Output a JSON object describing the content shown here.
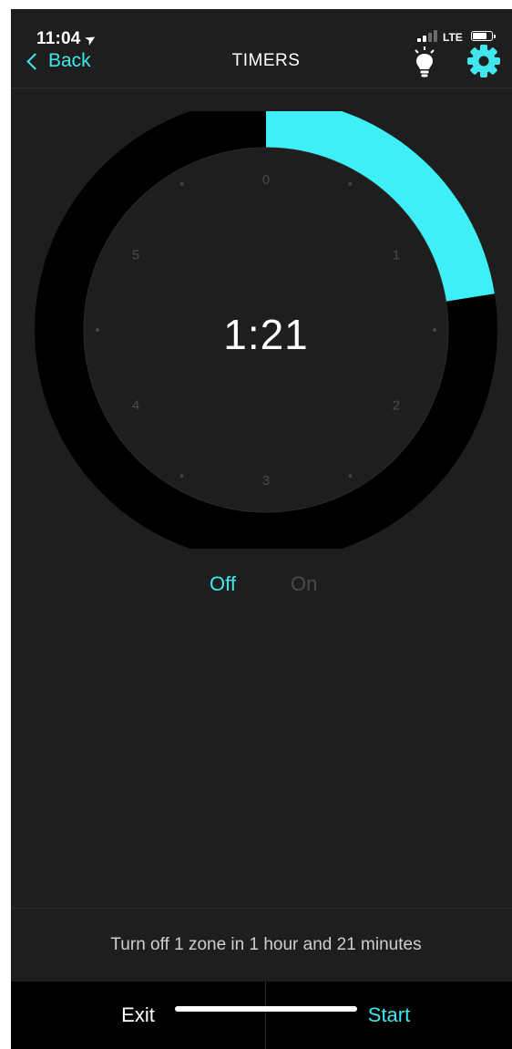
{
  "status_bar": {
    "time": "11:04",
    "location_icon": "location-arrow-icon",
    "signal_icon": "cellular-signal-icon",
    "network": "LTE",
    "battery_icon": "battery-icon",
    "battery_level": 0.8
  },
  "nav": {
    "back_label": "Back",
    "back_icon": "chevron-left-icon",
    "title": "TIMERS",
    "light_icon": "lightbulb-icon",
    "settings_icon": "gear-icon"
  },
  "dial": {
    "time_display": "1:21",
    "hour_labels": [
      "0",
      "1",
      "2",
      "3",
      "4",
      "5"
    ],
    "max_hours": 6,
    "selected_minutes": 81,
    "arc_color": "#3EF0F5",
    "track_color": "#000000",
    "face_color": "#1E1E1E"
  },
  "mode_toggle": {
    "off_label": "Off",
    "on_label": "On",
    "selected": "Off",
    "active_color": "#3EE8EE",
    "inactive_color": "#4A4A4A"
  },
  "summary": {
    "text": "Turn off 1 zone in 1 hour and 21 minutes"
  },
  "actions": {
    "exit_label": "Exit",
    "start_label": "Start"
  }
}
